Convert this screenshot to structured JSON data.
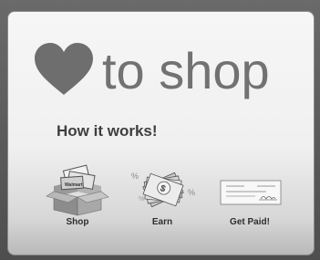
{
  "widget": {
    "headline": "to shop",
    "subheading": "How it works!",
    "steps": [
      {
        "label": "Shop",
        "icon": "shopping-box-icon"
      },
      {
        "label": "Earn",
        "icon": "money-cash-icon"
      },
      {
        "label": "Get Paid!",
        "icon": "check-payment-icon"
      }
    ],
    "box_brand_text": "Walmart",
    "colors": {
      "heart": "#6e6e6e",
      "headline_text": "#727272",
      "subheading_text": "#3e3e3e"
    }
  }
}
